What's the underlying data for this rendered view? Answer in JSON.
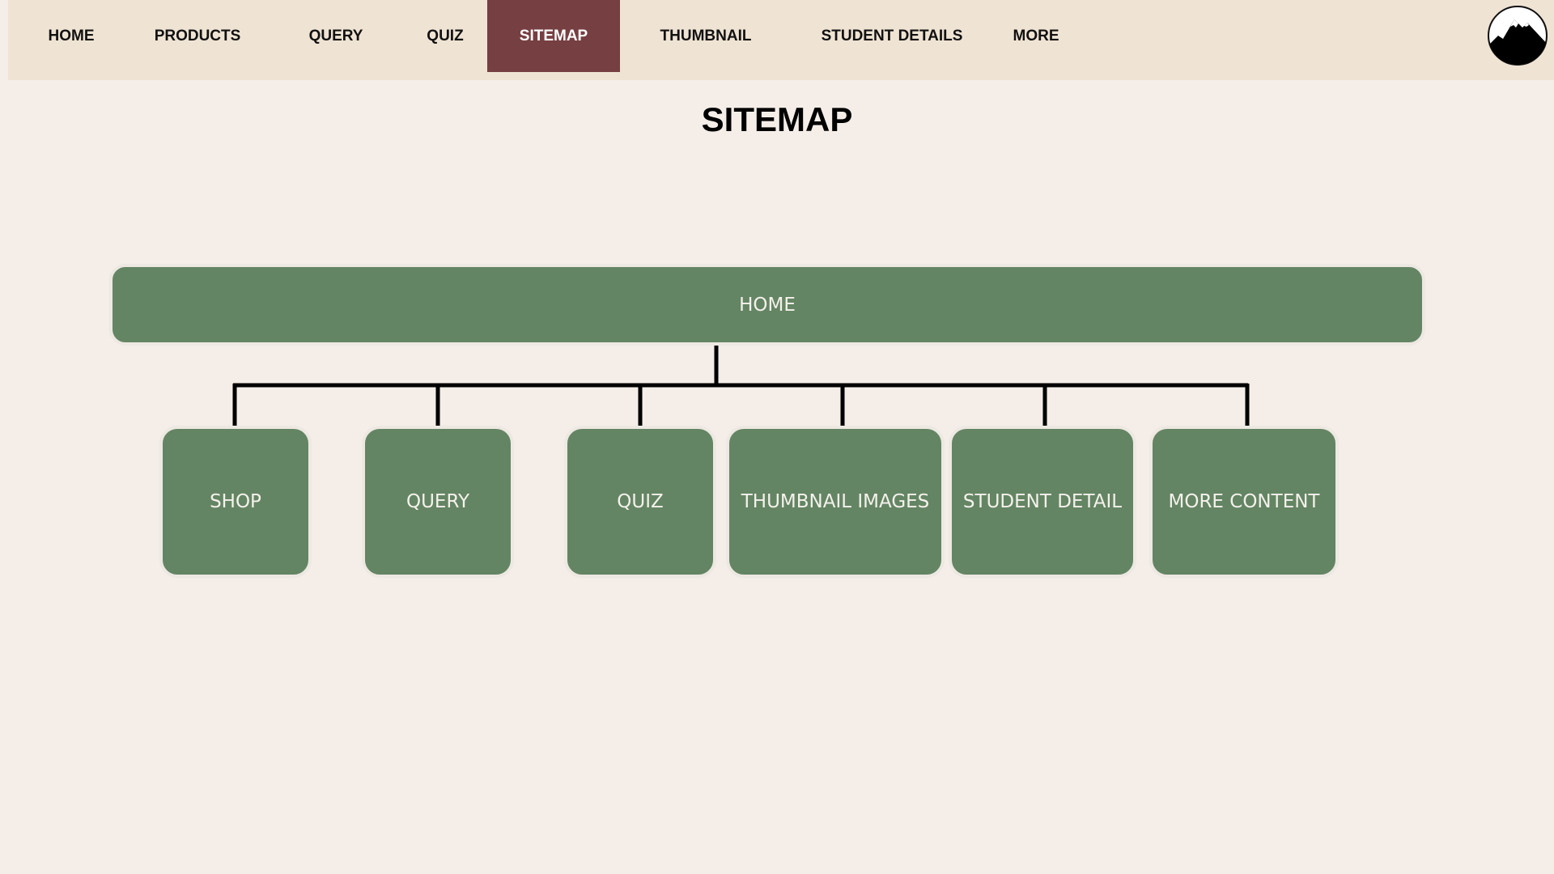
{
  "nav": {
    "items": [
      {
        "label": "HOME"
      },
      {
        "label": "PRODUCTS"
      },
      {
        "label": "QUERY"
      },
      {
        "label": "QUIZ"
      },
      {
        "label": "SITEMAP",
        "active": true
      },
      {
        "label": "THUMBNAIL"
      },
      {
        "label": "STUDENT DETAILS"
      },
      {
        "label": "MORE"
      }
    ],
    "logo_icon": "mountain-logo-icon"
  },
  "page": {
    "title": "SITEMAP"
  },
  "sitemap": {
    "root": {
      "label": "HOME"
    },
    "children": [
      {
        "label": "SHOP"
      },
      {
        "label": "QUERY"
      },
      {
        "label": "QUIZ"
      },
      {
        "label": "THUMBNAIL IMAGES"
      },
      {
        "label": "STUDENT DETAIL"
      },
      {
        "label": "MORE CONTENT"
      }
    ]
  },
  "colors": {
    "nav_background": "#efe3d3",
    "nav_active": "#763f42",
    "page_background": "#f5eee8",
    "node_fill": "#648563",
    "node_text": "#f4f1ec",
    "connector": "#000000"
  }
}
